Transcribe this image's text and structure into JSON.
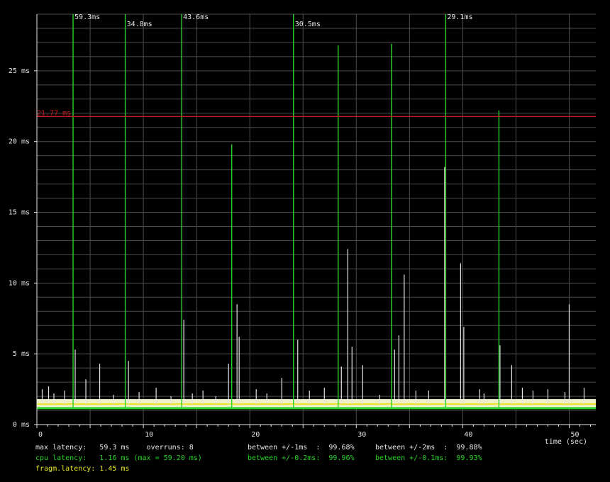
{
  "chart_data": {
    "type": "line",
    "title": "",
    "xlabel": "time (sec)",
    "ylabel": "",
    "xlim": [
      0,
      52.5
    ],
    "ylim": [
      0,
      29
    ],
    "x_ticks": [
      0,
      10,
      20,
      30,
      40,
      50
    ],
    "y_ticks": [
      0,
      5,
      10,
      15,
      20,
      25
    ],
    "y_tick_labels": [
      "0 ms",
      "5 ms",
      "10 ms",
      "15 ms",
      "20 ms",
      "25 ms"
    ],
    "grid": true,
    "colors": {
      "background": "#000000",
      "grid": "#4d4d4d",
      "axis": "#e6e6e6",
      "cpu_latency": "#28d228",
      "max_latency": "#e6e6e6",
      "fragm_latency": "#e6e62a",
      "threshold": "#c81e1e"
    },
    "threshold": {
      "value": 21.77,
      "label": "21.77 ms"
    },
    "cpu_latency_baseline": 1.16,
    "max_latency_baseline": 1.45,
    "series": [
      {
        "name": "cpu latency",
        "style": "spikes",
        "x": [
          3.4,
          8.3,
          13.6,
          18.3,
          24.1,
          28.3,
          33.3,
          38.4,
          43.4
        ],
        "values": [
          59.3,
          34.8,
          43.6,
          19.8,
          30.5,
          26.8,
          26.9,
          29.1,
          22.2
        ],
        "labels": [
          "59.3ms",
          "34.8ms",
          "43.6ms",
          "",
          "30.5ms",
          "",
          "",
          "29.1ms",
          ""
        ]
      },
      {
        "name": "max latency",
        "style": "spikes",
        "x": [
          0.5,
          1.1,
          1.6,
          2.6,
          3.6,
          4.6,
          5.9,
          7.2,
          8.6,
          9.6,
          11.2,
          12.6,
          13.8,
          14.6,
          15.6,
          16.8,
          18.0,
          18.8,
          19.0,
          20.6,
          21.6,
          23.0,
          24.5,
          25.6,
          27.0,
          28.6,
          29.2,
          29.6,
          30.6,
          32.2,
          33.6,
          34.0,
          34.5,
          35.6,
          36.8,
          38.3,
          39.8,
          40.1,
          41.6,
          42.0,
          43.5,
          44.6,
          45.6,
          46.6,
          48.0,
          49.6,
          50.0,
          51.4
        ],
        "values": [
          2.5,
          2.7,
          2.2,
          2.4,
          5.3,
          3.2,
          4.3,
          2.1,
          4.5,
          2.3,
          2.6,
          2.0,
          7.4,
          2.2,
          2.4,
          2.0,
          4.3,
          8.5,
          6.2,
          2.5,
          2.2,
          3.3,
          6.0,
          2.4,
          2.6,
          4.1,
          12.4,
          5.5,
          4.2,
          2.1,
          5.3,
          6.3,
          10.6,
          2.4,
          2.4,
          18.2,
          11.4,
          6.9,
          2.5,
          2.2,
          5.6,
          4.2,
          2.6,
          2.4,
          2.5,
          2.3,
          8.5,
          2.6
        ]
      },
      {
        "name": "fragm.latency",
        "style": "band",
        "values": [
          1.45
        ]
      }
    ]
  },
  "stats": {
    "line1": "max latency:   59.3 ms    overruns: 8",
    "line2": "cpu latency:   1.16 ms (max = 59.20 ms)",
    "line3": "fragm.latency: 1.45 ms",
    "r1c2": "between +/-1ms  :  99.68%",
    "r1c3": "between +/-2ms  :  99.88%",
    "r2c2": "between +/-0.2ms:  99.96%",
    "r2c3": "between +/-0.1ms:  99.93%"
  }
}
